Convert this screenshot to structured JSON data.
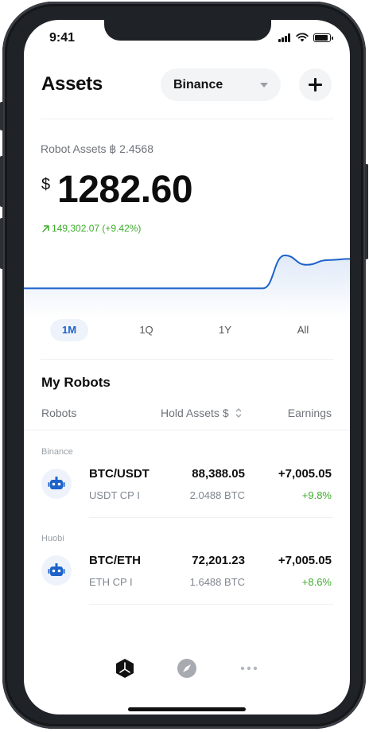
{
  "status": {
    "time": "9:41"
  },
  "header": {
    "title": "Assets",
    "exchange": "Binance",
    "add_icon": "plus-icon"
  },
  "summary": {
    "robot_assets": "Robot Assets ฿ 2.4568",
    "currency": "$",
    "balance": "1282.60",
    "change": "149,302.07 (+9.42%)",
    "change_color": "#3eac2b"
  },
  "chart_data": {
    "type": "area",
    "x": [
      0,
      1,
      2,
      3,
      4,
      5,
      6,
      7,
      8,
      9,
      10,
      11,
      12,
      13,
      14,
      15
    ],
    "values": [
      20,
      20,
      20,
      20,
      20,
      20,
      20,
      20,
      20,
      20,
      20,
      20,
      48,
      40,
      44,
      45
    ],
    "color": "#1d62c9",
    "grid": false
  },
  "periods": [
    {
      "label": "1M",
      "active": true
    },
    {
      "label": "1Q",
      "active": false
    },
    {
      "label": "1Y",
      "active": false
    },
    {
      "label": "All",
      "active": false
    }
  ],
  "robots": {
    "title": "My Robots",
    "columns": {
      "robots": "Robots",
      "hold": "Hold Assets $",
      "earnings": "Earnings"
    },
    "groups": [
      {
        "exchange": "Binance",
        "pair": "BTC/USDT",
        "strategy": "USDT CP I",
        "hold": "88,388.05",
        "hold_btc": "2.0488 BTC",
        "earnings": "+7,005.05",
        "earnings_pct": "+9.8%",
        "icon": "robot-icon"
      },
      {
        "exchange": "Huobi",
        "pair": "BTC/ETH",
        "strategy": "ETH CP I",
        "hold": "72,201.23",
        "hold_btc": "1.6488 BTC",
        "earnings": "+7,005.05",
        "earnings_pct": "+8.6%",
        "icon": "robot-icon"
      }
    ]
  },
  "tabbar": {
    "items": [
      "home-icon",
      "compass-icon",
      "more-icon"
    ]
  },
  "colors": {
    "accent": "#1d62c9",
    "positive": "#3eac2b"
  }
}
